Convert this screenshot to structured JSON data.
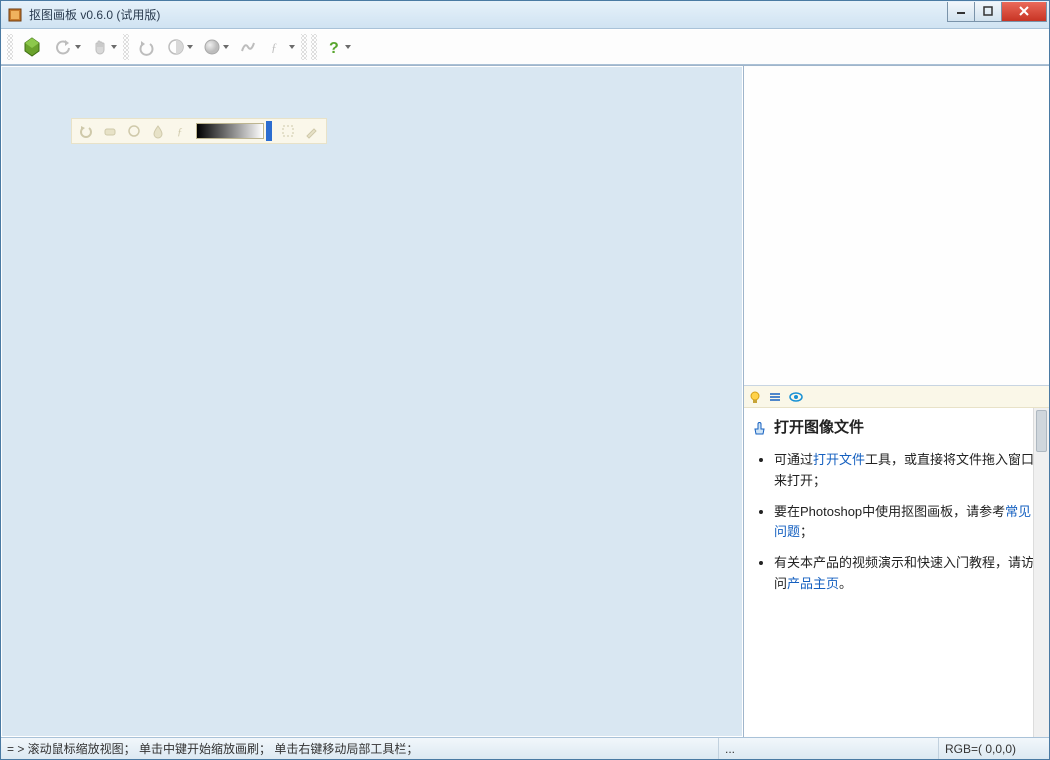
{
  "title": "抠图画板 v0.6.0 (试用版)",
  "toolbar_icons": {
    "open": "open-file",
    "undo": "undo",
    "hand": "hand",
    "undo2": "undo",
    "threshold": "threshold",
    "sphere": "sphere",
    "wave": "wave",
    "fx": "fx",
    "help": "help"
  },
  "local_toolbar": {
    "icons": [
      "undo",
      "eraser",
      "circle",
      "drop",
      "fx"
    ],
    "right_icons": [
      "crop",
      "brush"
    ]
  },
  "help_panel": {
    "heading": "打开图像文件",
    "items": [
      {
        "pre": "可通过",
        "link": "打开文件",
        "post": "工具，或直接将文件拖入窗口来打开；"
      },
      {
        "pre": "要在Photoshop中使用抠图画板，请参考",
        "link": "常见问题",
        "post": "；"
      },
      {
        "pre": "有关本产品的视频演示和快速入门教程，请访问",
        "link": "产品主页",
        "post": "。"
      }
    ]
  },
  "statusbar": {
    "hint": "= >  滚动鼠标缩放视图； 单击中键开始缩放画刷； 单击右键移动局部工具栏；",
    "dots": "...",
    "rgb": "RGB=( 0,0,0)"
  }
}
